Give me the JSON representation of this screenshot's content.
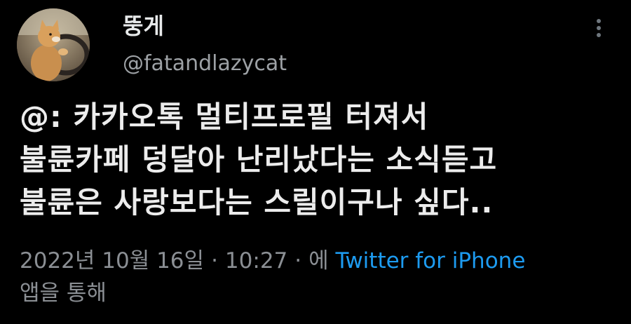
{
  "tweet": {
    "display_name": "뚱게",
    "handle": "@fatandlazycat",
    "text_lines": [
      "@: 카카오톡 멀티프로필 터져서",
      "불륜카페 덩달아 난리났다는 소식듣고",
      "불륜은 사랑보다는 스릴이구나 싶다.."
    ],
    "date": "2022년 10월 16일",
    "separator": "·",
    "time": "10:27",
    "via_prefix": "에",
    "source": "Twitter for iPhone",
    "via_suffix": "앱을 통해"
  },
  "icons": {
    "more": "more-vertical-icon",
    "avatar": "cat-driving-avatar"
  },
  "colors": {
    "background": "#000000",
    "text": "#e7e9ea",
    "secondary_text": "#8b8f94",
    "link": "#1d9bf0"
  }
}
